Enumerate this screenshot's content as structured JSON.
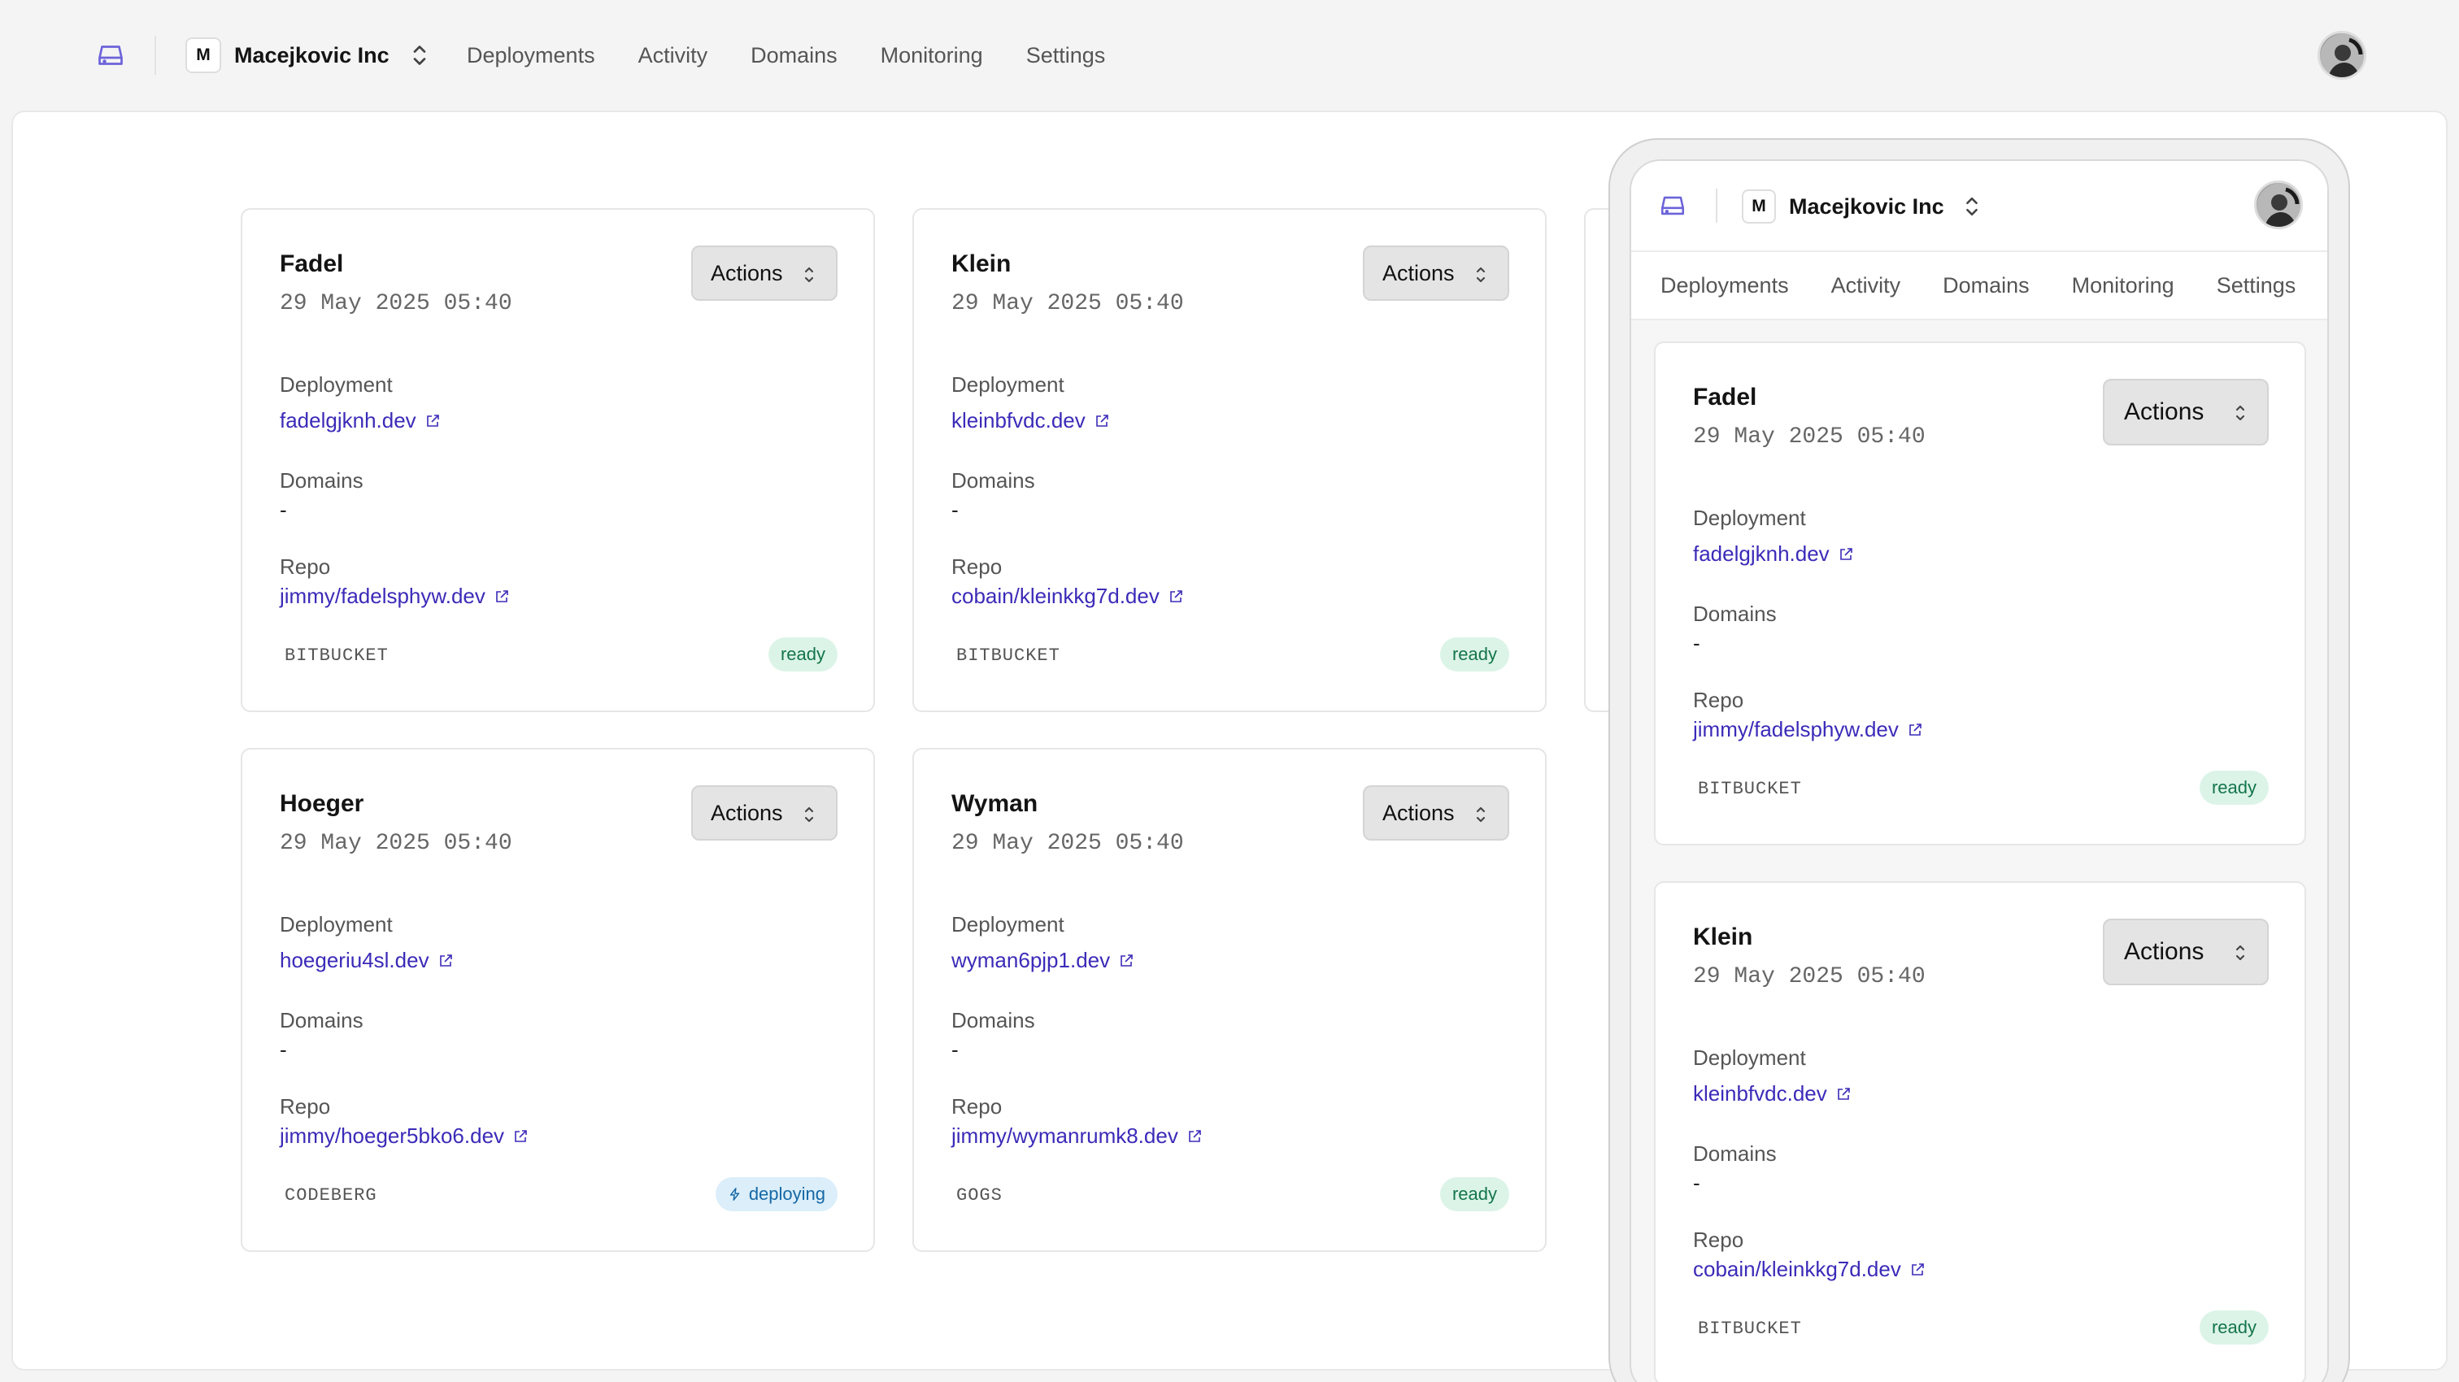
{
  "header": {
    "org_badge": "M",
    "org_name": "Macejkovic Inc",
    "nav": [
      "Deployments",
      "Activity",
      "Domains",
      "Monitoring",
      "Settings"
    ]
  },
  "labels": {
    "actions": "Actions",
    "deployment": "Deployment",
    "domains": "Domains",
    "repo": "Repo",
    "empty_domain": "-"
  },
  "cards": [
    {
      "name": "Fadel",
      "time": "29 May 2025 05:40",
      "deployment": "fadelgjknh.dev",
      "domains": "-",
      "repo": "jimmy/fadelsphyw.dev",
      "provider": "BITBUCKET",
      "status": "ready"
    },
    {
      "name": "Klein",
      "time": "29 May 2025 05:40",
      "deployment": "kleinbfvdc.dev",
      "domains": "-",
      "repo": "cobain/kleinkkg7d.dev",
      "provider": "BITBUCKET",
      "status": "ready"
    },
    {
      "name": "Hoeger",
      "time": "29 May 2025 05:40",
      "deployment": "hoegeriu4sl.dev",
      "domains": "-",
      "repo": "jimmy/hoeger5bko6.dev",
      "provider": "CODEBERG",
      "status": "deploying"
    },
    {
      "name": "Wyman",
      "time": "29 May 2025 05:40",
      "deployment": "wyman6pjp1.dev",
      "domains": "-",
      "repo": "jimmy/wymanrumk8.dev",
      "provider": "GOGS",
      "status": "ready"
    }
  ],
  "colors": {
    "link": "#3b2bb8",
    "ready_bg": "#dcf4e8",
    "ready_fg": "#14754a",
    "deploying_bg": "#dbeefa",
    "deploying_fg": "#1568a6",
    "logo": "#6c63d9"
  },
  "icons": {
    "logo": "server-drive-icon",
    "chevron": "chevron-up-down-icon",
    "external": "external-link-icon",
    "deploying": "lightning-bolt-icon"
  }
}
